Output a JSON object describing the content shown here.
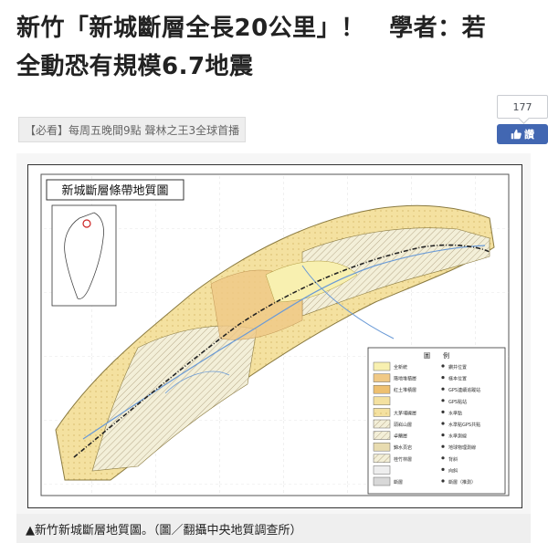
{
  "headline": {
    "line1": "新竹「新城斷層全長20公里」！　學者：若",
    "line2": "全動恐有規模6.7地震"
  },
  "like_widget": {
    "count": "177",
    "button_label": "讚",
    "button_color": "#4267b2"
  },
  "promo_banner": {
    "text": "【必看】每周五晚間9點 聲林之王3全球首播"
  },
  "figure": {
    "map_title": "新城斷層條帶地質圖",
    "legend_title": "圖　　例",
    "legend_labels": [
      "全新統",
      "階地堆積層",
      "紅土堆積層",
      "",
      "大茅埔礫層",
      "頭嵙山層",
      "卓蘭層",
      "錦水頁岩",
      "桂竹林層",
      "",
      "斷層"
    ],
    "legend_symbols": [
      "鑽井位置",
      "樣本位置",
      "GPS連續追蹤站",
      "GPS點站",
      "水準點",
      "水準點GPS共點",
      "水準測線",
      "地球物理測線",
      "背斜",
      "向斜",
      "斷層（推測）"
    ],
    "caption": "▲新竹新城斷層地質圖。（圖／翻攝中央地質調查所）"
  }
}
